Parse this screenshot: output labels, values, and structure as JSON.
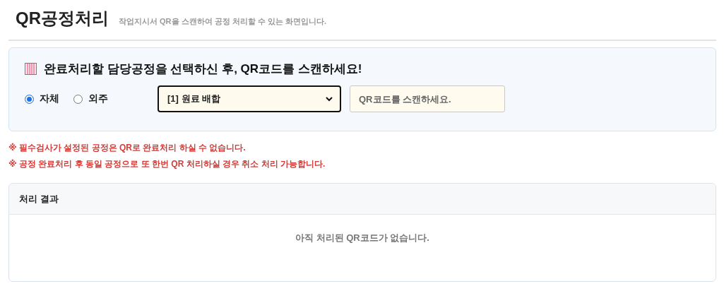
{
  "header": {
    "title": "QR공정처리",
    "subtitle": "작업지시서 QR을 스캔하여 공정 처리할 수 있는 화면입니다."
  },
  "scan_panel": {
    "heading": "완료처리할 담당공정을 선택하신 후, QR코드를 스캔하세요!",
    "options": [
      {
        "label": "자체",
        "selected": true
      },
      {
        "label": "외주",
        "selected": false
      }
    ],
    "process_select": {
      "value": "[1] 원료 배합"
    },
    "qr_input": {
      "placeholder": "QR코드를 스캔하세요."
    }
  },
  "notes": [
    "※ 필수검사가 설정된 공정은 QR로 완료처리 하실 수 없습니다.",
    "※ 공정 완료처리 후 동일 공정으로 또 한번 QR 처리하실 경우 취소 처리 가능합니다."
  ],
  "result": {
    "title": "처리 결과",
    "empty_message": "아직 처리된 QR코드가 없습니다."
  }
}
